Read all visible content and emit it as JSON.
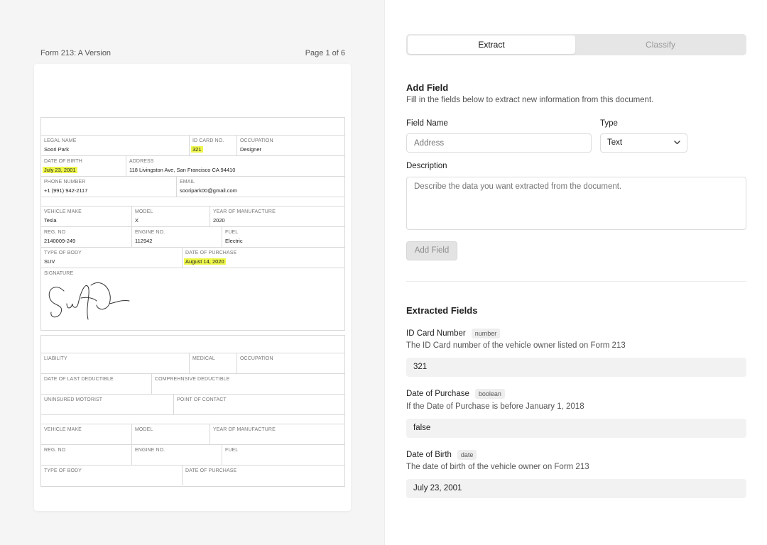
{
  "document": {
    "title": "Form 213: A Version",
    "page_indicator": "Page 1 of 6",
    "owner": {
      "legal_name_label": "LEGAL NAME",
      "legal_name": "Soori Park",
      "id_label": "ID CARD NO.",
      "id_value": "321",
      "occupation_label": "OCCUPATION",
      "occupation": "Designer",
      "dob_label": "DATE OF BIRTH",
      "dob": "July 23, 2001",
      "address_label": "ADDRESS",
      "address": "118 Livingston Ave, San Francisco CA 94410",
      "phone_label": "PHONE NUMBER",
      "phone": "+1 (991) 942-2117",
      "email_label": "EMAIL",
      "email": "sooripark00@gmail.com"
    },
    "vehicle": {
      "make_label": "VEHICLE MAKE",
      "make": "Tesla",
      "model_label": "MODEL",
      "model": "X",
      "year_label": "YEAR OF MANUFACTURE",
      "year": "2020",
      "reg_label": "REG. NO",
      "reg": "2140009-249",
      "engine_label": "ENGINE NO.",
      "engine": "112942",
      "fuel_label": "FUEL",
      "fuel": "Electric",
      "body_label": "TYPE OF BODY",
      "body": "SUV",
      "purchase_label": "DATE OF PURCHASE",
      "purchase": "August 14, 2020",
      "signature_label": "SIGNATURE"
    },
    "insurance": {
      "liability_label": "LIABILITY",
      "medical_label": "MEDICAL",
      "occupation_label": "OCCUPATION",
      "last_deductible_label": "DATE OF LAST DEDUCTIBLE",
      "comprehensive_label": "COMPREHNSIVE DEDUCTIBLE",
      "uninsured_label": "UNINSURED MOTORIST",
      "contact_label": "POINT OF CONTACT"
    },
    "vehicle2": {
      "make_label": "VEHICLE MAKE",
      "model_label": "MODEL",
      "year_label": "YEAR OF MANUFACTURE",
      "reg_label": "REG. NO",
      "engine_label": "ENGINE NO.",
      "fuel_label": "FUEL",
      "body_label": "TYPE OF BODY",
      "purchase_label": "DATE OF PURCHASE"
    }
  },
  "tabs": {
    "extract": "Extract",
    "classify": "Classify"
  },
  "add_field": {
    "heading": "Add Field",
    "subtitle": "Fill in the fields below to extract new information from this document.",
    "field_name_label": "Field Name",
    "field_name_placeholder": "Address",
    "type_label": "Type",
    "type_value": "Text",
    "description_label": "Description",
    "description_placeholder": "Describe the data you want extracted from the document.",
    "button": "Add Field"
  },
  "extracted": {
    "heading": "Extracted Fields",
    "fields": [
      {
        "name": "ID Card Number",
        "type": "number",
        "description": "The ID Card number of the vehicle owner listed on Form 213",
        "value": "321"
      },
      {
        "name": "Date of Purchase",
        "type": "boolean",
        "description": "If the Date of Purchase is before January 1, 2018",
        "value": "false"
      },
      {
        "name": "Date of Birth",
        "type": "date",
        "description": "The date of birth of the vehicle owner on Form 213",
        "value": "July 23, 2001"
      }
    ]
  },
  "colors": {
    "highlight": "#eef74a",
    "accent_bg": "#f2f2f2"
  }
}
